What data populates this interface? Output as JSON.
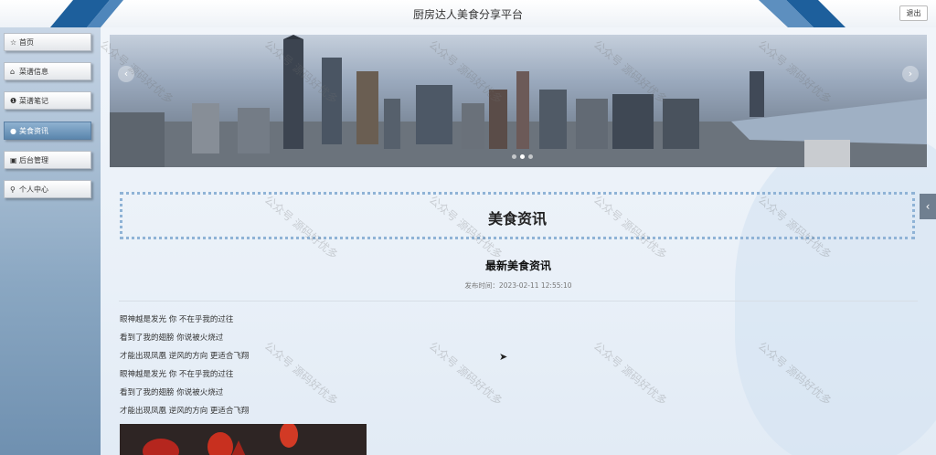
{
  "header": {
    "title": "厨房达人美食分享平台",
    "logout_label": "退出"
  },
  "sidebar": {
    "items": [
      {
        "label": "首页",
        "icon": "star-icon",
        "active": false
      },
      {
        "label": "菜谱信息",
        "icon": "bag-icon",
        "active": false
      },
      {
        "label": "菜谱笔记",
        "icon": "info-icon",
        "active": false
      },
      {
        "label": "美食资讯",
        "icon": "dot-icon",
        "active": true
      },
      {
        "label": "后台管理",
        "icon": "calendar-icon",
        "active": false
      },
      {
        "label": "个人中心",
        "icon": "user-icon",
        "active": false
      }
    ]
  },
  "banner": {
    "prev_glyph": "‹",
    "next_glyph": "›",
    "slide_count": 3,
    "active_slide": 2
  },
  "section": {
    "title": "美食资讯"
  },
  "article": {
    "title": "最新美食资讯",
    "time_label": "发布时间：2023-02-11 12:55:10",
    "lines": [
      "眼神越是发光 你 不在乎我的过往",
      "看到了我的翅膀 你说被火烧过",
      "才能出现凤凰 逆风的方向 更适合飞翔",
      "眼神越是发光 你 不在乎我的过往",
      "看到了我的翅膀 你说被火烧过",
      "才能出现凤凰 逆风的方向 更适合飞翔"
    ]
  },
  "side_tab_glyph": "‹",
  "watermark": "公众号 源码好优多",
  "colors": {
    "accent": "#5b86ad",
    "dotted_border": "#8fb3d6",
    "stripe": "#1d5f9c"
  }
}
